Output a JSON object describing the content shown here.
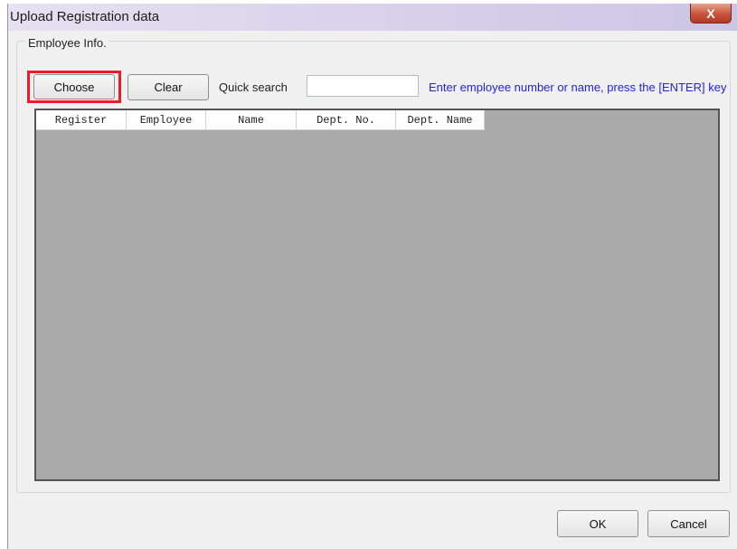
{
  "window": {
    "title": "Upload Registration data",
    "close_glyph": "X"
  },
  "group": {
    "label": "Employee Info."
  },
  "toolbar": {
    "choose_label": "Choose",
    "clear_label": "Clear",
    "quick_search_label": "Quick search",
    "search_value": "",
    "hint": "Enter employee number or name, press the [ENTER] key"
  },
  "grid": {
    "columns": [
      "Register",
      "Employee",
      "Name",
      "Dept. No.",
      "Dept. Name"
    ],
    "rows": []
  },
  "footer": {
    "ok_label": "OK",
    "cancel_label": "Cancel"
  },
  "colors": {
    "highlight": "#ee1c24",
    "hint_text": "#2323e0",
    "grid_background": "#ababab"
  }
}
